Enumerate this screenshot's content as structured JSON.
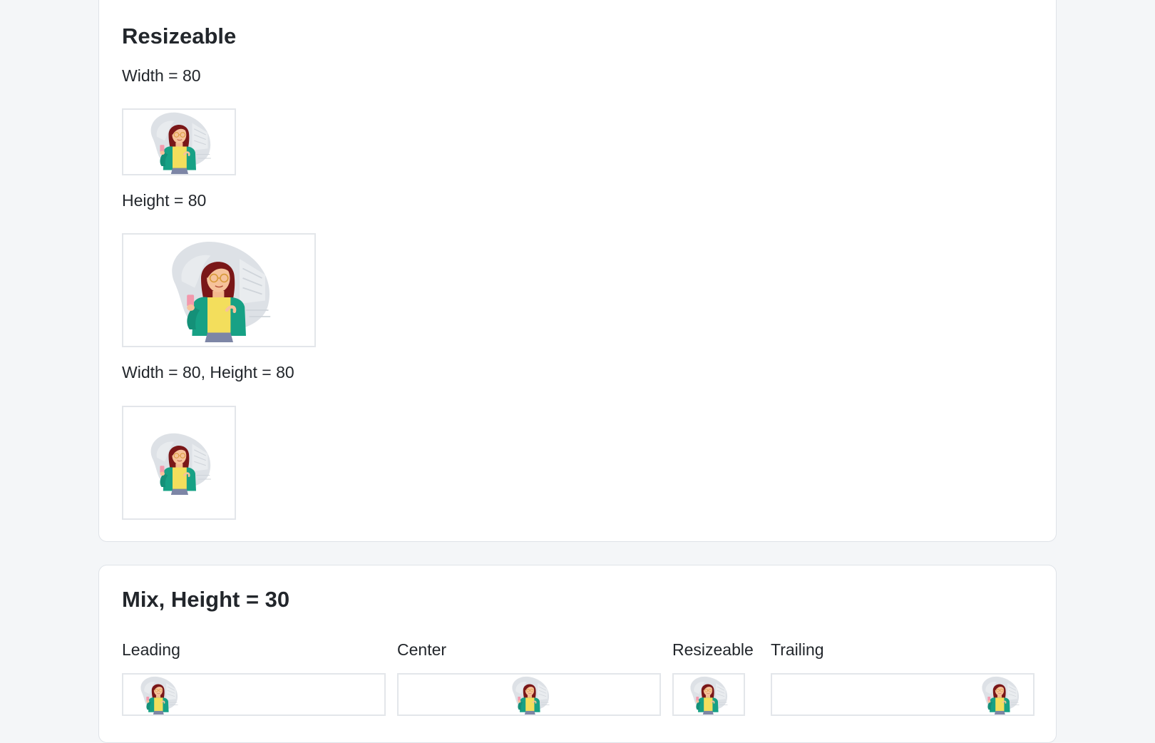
{
  "resizeable_section": {
    "title": "Resizeable",
    "examples": [
      {
        "label": "Width = 80",
        "image_alt": "woman-with-phone-illustration"
      },
      {
        "label": "Height = 80",
        "image_alt": "woman-with-phone-illustration"
      },
      {
        "label": "Width = 80, Height = 80",
        "image_alt": "woman-with-phone-illustration"
      }
    ]
  },
  "mix_section": {
    "title": "Mix, Height = 30",
    "columns": [
      {
        "label": "Leading"
      },
      {
        "label": "Center"
      },
      {
        "label": "Resizeable"
      },
      {
        "label": "Trailing"
      }
    ]
  },
  "colors": {
    "page_background": "#f4f6f8",
    "card_background": "#ffffff",
    "card_border": "#dfe3e8",
    "text": "#22262b"
  }
}
